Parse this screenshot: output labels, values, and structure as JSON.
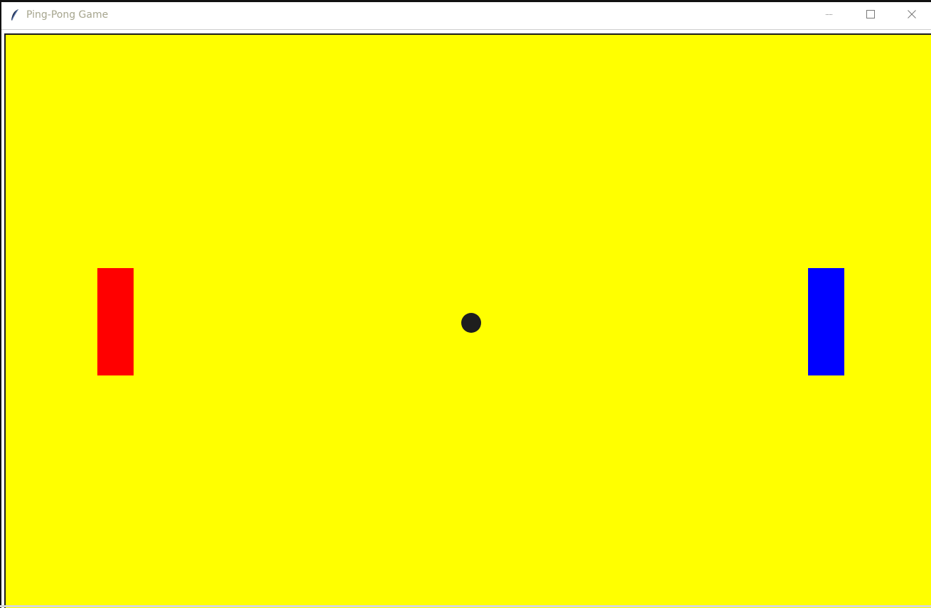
{
  "window": {
    "title": "Ping-Pong Game",
    "icon": "feather-icon",
    "controls": {
      "minimize_icon": "minimize-icon",
      "maximize_icon": "maximize-icon",
      "close_icon": "close-icon"
    }
  },
  "game": {
    "background_color": "#ffff00",
    "left_paddle": {
      "color": "#ff0000"
    },
    "right_paddle": {
      "color": "#0000ff"
    },
    "ball": {
      "color": "#1e1e1e"
    }
  }
}
